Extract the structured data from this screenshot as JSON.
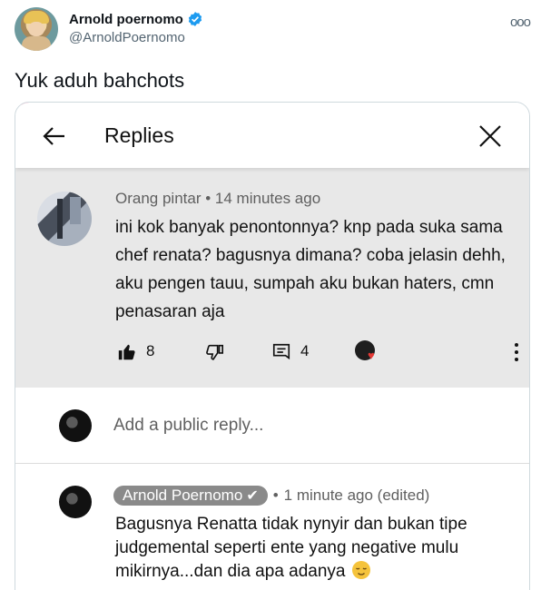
{
  "tweet": {
    "display_name": "Arnold poernomo",
    "handle": "@ArnoldPoernomo",
    "text": "Yuk aduh bahchots",
    "more_icon": "ooo",
    "verified_color": "#1d9bf0"
  },
  "embed": {
    "header": {
      "title": "Replies",
      "back_icon": "arrow-left-icon",
      "close_icon": "close-icon"
    },
    "parent_comment": {
      "author": "Orang pintar",
      "separator": "•",
      "time": "14 minutes ago",
      "text": "ini kok banyak penontonnya? knp pada suka sama chef renata? bagusnya dimana? coba jelasin dehh, aku pengen tauu, sumpah aku bukan haters, cmn penasaran aja",
      "likes": "8",
      "replies": "4",
      "heart_color": "#e53935"
    },
    "add_reply": {
      "placeholder": "Add a public reply..."
    },
    "reply": {
      "author": "Arnold Poernomo",
      "check": "✔",
      "separator": "•",
      "time": "1 minute ago (edited)",
      "text": "Bagusnya Renatta tidak nynyir dan bukan tipe judgemental seperti ente yang negative mulu mikirnya...dan dia apa adanya"
    }
  }
}
